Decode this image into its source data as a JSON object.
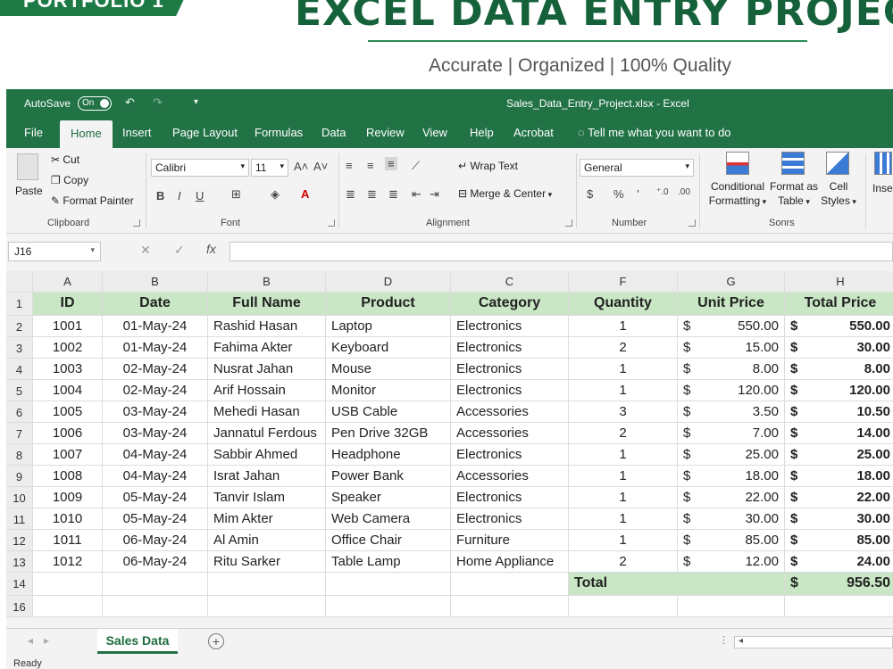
{
  "banner": {
    "tag": "PORTFOLIO 1",
    "title": "EXCEL DATA ENTRY PROJECT",
    "subtitle": "Accurate | Organized | 100% Quality"
  },
  "titlebar": {
    "autosave_label": "AutoSave",
    "autosave_state": "On",
    "document_title": "Sales_Data_Entry_Project.xlsx  -  Excel"
  },
  "ribbon_tabs": [
    "File",
    "Home",
    "Insert",
    "Page Layout",
    "Formulas",
    "Data",
    "Review",
    "View",
    "Help",
    "Acrobat"
  ],
  "active_tab": "Home",
  "tell_me": "Tell me what you want to do",
  "ribbon": {
    "clipboard": {
      "paste": "Paste",
      "cut": "Cut",
      "copy": "Copy",
      "format_painter": "Format Painter",
      "label": "Clipboard"
    },
    "font": {
      "name": "Calibri",
      "size": "11",
      "label": "Font",
      "bold": "B",
      "italic": "I",
      "underline": "U"
    },
    "alignment": {
      "wrap_text": "Wrap Text",
      "merge_center": "Merge & Center",
      "label": "Alignment"
    },
    "number": {
      "format": "General",
      "currency": "$",
      "percent": "%",
      "comma": "’",
      "label": "Number"
    },
    "styles": {
      "conditional": "Conditional",
      "formatting": "Formatting",
      "format_as": "Format as",
      "table": "Table",
      "cell": "Cell",
      "cell_styles": "Styles",
      "label": "Sonrs"
    },
    "cells": {
      "insert": "Inse"
    }
  },
  "formula_bar": {
    "name_box": "J16",
    "fx": "fx"
  },
  "grid": {
    "column_letters": [
      "A",
      "B",
      "B",
      "D",
      "C",
      "F",
      "G",
      "H"
    ],
    "headers": [
      "ID",
      "Date",
      "Full Name",
      "Product",
      "Category",
      "Quantity",
      "Unit Price",
      "Total Price"
    ],
    "row_numbers": [
      "1",
      "2",
      "3",
      "4",
      "5",
      "6",
      "7",
      "8",
      "9",
      "10",
      "11",
      "12",
      "13",
      "14",
      "16"
    ],
    "rows": [
      [
        "1001",
        "01-May-24",
        "Rashid Hasan",
        "Laptop",
        "Electronics",
        "1",
        "550.00",
        "550.00"
      ],
      [
        "1002",
        "01-May-24",
        "Fahima Akter",
        "Keyboard",
        "Electronics",
        "2",
        "15.00",
        "30.00"
      ],
      [
        "1003",
        "02-May-24",
        "Nusrat Jahan",
        "Mouse",
        "Electronics",
        "1",
        "8.00",
        "8.00"
      ],
      [
        "1004",
        "02-May-24",
        "Arif Hossain",
        "Monitor",
        "Electronics",
        "1",
        "120.00",
        "120.00"
      ],
      [
        "1005",
        "03-May-24",
        "Mehedi Hasan",
        "USB Cable",
        "Accessories",
        "3",
        "3.50",
        "10.50"
      ],
      [
        "1006",
        "03-May-24",
        "Jannatul Ferdous",
        "Pen Drive 32GB",
        "Accessories",
        "2",
        "7.00",
        "14.00"
      ],
      [
        "1007",
        "04-May-24",
        "Sabbir Ahmed",
        "Headphone",
        "Electronics",
        "1",
        "25.00",
        "25.00"
      ],
      [
        "1008",
        "04-May-24",
        "Israt Jahan",
        "Power Bank",
        "Accessories",
        "1",
        "18.00",
        "18.00"
      ],
      [
        "1009",
        "05-May-24",
        "Tanvir Islam",
        "Speaker",
        "Electronics",
        "1",
        "22.00",
        "22.00"
      ],
      [
        "1010",
        "05-May-24",
        "Mim Akter",
        "Web Camera",
        "Electronics",
        "1",
        "30.00",
        "30.00"
      ],
      [
        "1011",
        "06-May-24",
        "Al Amin",
        "Office Chair",
        "Furniture",
        "1",
        "85.00",
        "85.00"
      ],
      [
        "1012",
        "06-May-24",
        "Ritu Sarker",
        "Table Lamp",
        "Home Appliance",
        "2",
        "12.00",
        "24.00"
      ]
    ],
    "currency_symbol": "$",
    "total_label": "Total",
    "total_value": "956.50"
  },
  "sheet_tabs": [
    "Sales Data"
  ],
  "status": "Ready",
  "colors": {
    "excel_green": "#217346",
    "header_fill": "#c9e7c5",
    "title_green": "#15613a"
  }
}
